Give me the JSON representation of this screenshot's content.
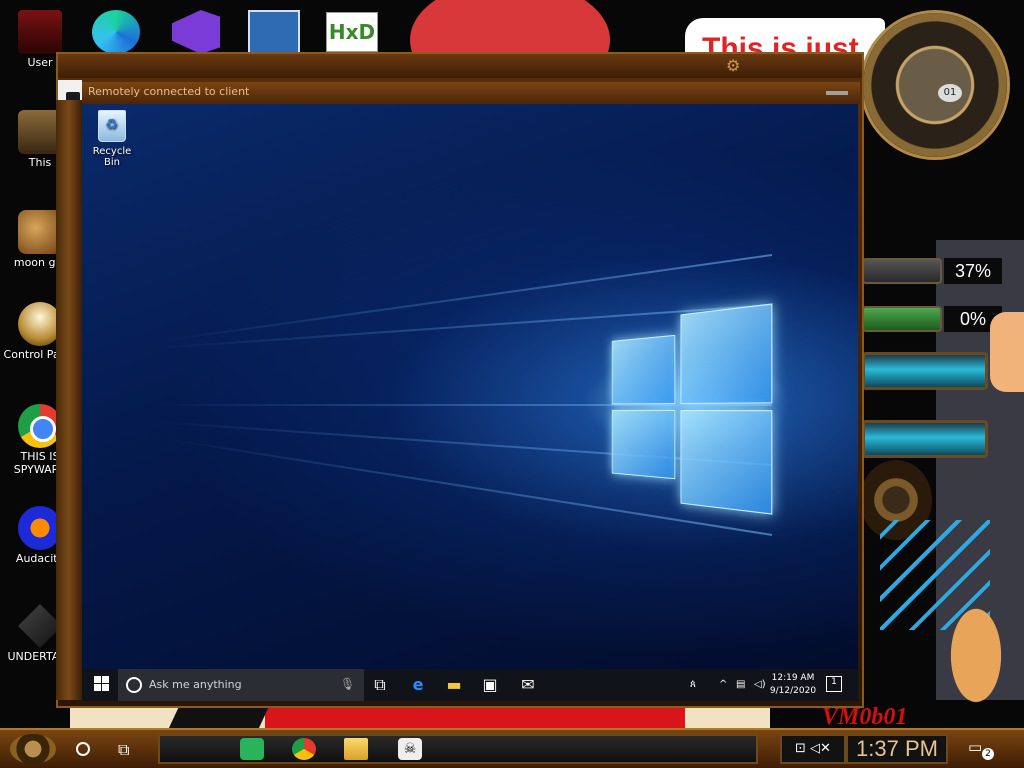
{
  "desktop": {
    "icons": [
      {
        "label": "User"
      },
      {
        "label": "This"
      },
      {
        "label": "moon girl"
      },
      {
        "label": "Control Panel"
      },
      {
        "label": "THIS IS SPYWARE"
      },
      {
        "label": "Audacity"
      },
      {
        "label": "UNDERTALE"
      }
    ],
    "top_apps": [
      "edge-icon",
      "visual-studio-icon",
      "virtualbox-icon",
      "hxd-icon"
    ],
    "hxd_label": "HxD",
    "banner_text": "This is just",
    "watermark": "VM0b01"
  },
  "window": {
    "title": "Remotely connected to client",
    "gear_glyph": "⚙"
  },
  "remote": {
    "recycle_bin_label": "Recycle Bin",
    "search_placeholder": "Ask me anything",
    "clock_time": "12:19 AM",
    "clock_date": "9/12/2020",
    "notification_count": "1"
  },
  "widgets": {
    "clock_number": "01",
    "cpu_percent": "37%",
    "mem_percent": "0%"
  },
  "taskbar": {
    "time": "1:37 PM",
    "notification_count": "2"
  },
  "colors": {
    "accent_brown": "#7a4512",
    "banner_red": "#e02424",
    "remote_bg": "#04184a"
  }
}
